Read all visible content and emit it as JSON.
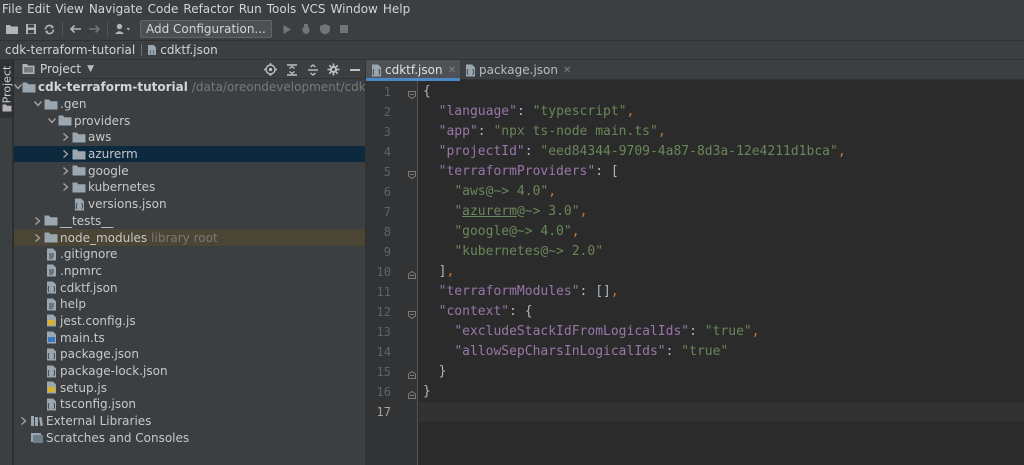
{
  "menu": [
    "File",
    "Edit",
    "View",
    "Navigate",
    "Code",
    "Refactor",
    "Run",
    "Tools",
    "VCS",
    "Window",
    "Help"
  ],
  "toolbar": {
    "add_configuration": "Add Configuration...",
    "icons": [
      "open-folder-icon",
      "save-icon",
      "sync-icon",
      "back-arrow-icon",
      "forward-arrow-icon",
      "user-icon",
      "run-icon",
      "debug-icon",
      "coverage-icon",
      "stop-icon"
    ]
  },
  "breadcrumb": [
    "cdk-terraform-tutorial",
    "cdktf.json"
  ],
  "tool_strip": {
    "label": "Project"
  },
  "project_panel": {
    "title": "Project",
    "icons": [
      "locate-icon",
      "collapse-all-icon",
      "expand-icon",
      "gear-icon",
      "hide-icon"
    ],
    "tree": [
      {
        "label": "cdk-terraform-tutorial",
        "note": "/data/oreondevelopment/cdk-terraform-",
        "type": "folder",
        "depth": 0,
        "arrow": "down",
        "bold": true
      },
      {
        "label": ".gen",
        "note": "",
        "type": "folder",
        "depth": 1,
        "arrow": "down"
      },
      {
        "label": "providers",
        "note": "",
        "type": "folder",
        "depth": 2,
        "arrow": "down"
      },
      {
        "label": "aws",
        "note": "",
        "type": "folder",
        "depth": 3,
        "arrow": "right"
      },
      {
        "label": "azurerm",
        "note": "",
        "type": "folder",
        "depth": 3,
        "arrow": "right",
        "selected": true
      },
      {
        "label": "google",
        "note": "",
        "type": "folder",
        "depth": 3,
        "arrow": "right"
      },
      {
        "label": "kubernetes",
        "note": "",
        "type": "folder",
        "depth": 3,
        "arrow": "right"
      },
      {
        "label": "versions.json",
        "note": "",
        "type": "json",
        "depth": 3,
        "arrow": "none"
      },
      {
        "label": "__tests__",
        "note": "",
        "type": "folder",
        "depth": 1,
        "arrow": "right"
      },
      {
        "label": "node_modules",
        "note": "library root",
        "type": "folder",
        "depth": 1,
        "arrow": "right",
        "excluded": true
      },
      {
        "label": ".gitignore",
        "note": "",
        "type": "file",
        "depth": 1,
        "arrow": "none"
      },
      {
        "label": ".npmrc",
        "note": "",
        "type": "file",
        "depth": 1,
        "arrow": "none"
      },
      {
        "label": "cdktf.json",
        "note": "",
        "type": "json",
        "depth": 1,
        "arrow": "none"
      },
      {
        "label": "help",
        "note": "",
        "type": "file",
        "depth": 1,
        "arrow": "none"
      },
      {
        "label": "jest.config.js",
        "note": "",
        "type": "js",
        "depth": 1,
        "arrow": "none"
      },
      {
        "label": "main.ts",
        "note": "",
        "type": "ts",
        "depth": 1,
        "arrow": "none"
      },
      {
        "label": "package.json",
        "note": "",
        "type": "json",
        "depth": 1,
        "arrow": "none"
      },
      {
        "label": "package-lock.json",
        "note": "",
        "type": "json",
        "depth": 1,
        "arrow": "none"
      },
      {
        "label": "setup.js",
        "note": "",
        "type": "js",
        "depth": 1,
        "arrow": "none"
      },
      {
        "label": "tsconfig.json",
        "note": "",
        "type": "json",
        "depth": 1,
        "arrow": "none"
      },
      {
        "label": "External Libraries",
        "note": "",
        "type": "library",
        "depth": 0,
        "arrow": "right"
      },
      {
        "label": "Scratches and Consoles",
        "note": "",
        "type": "scratch",
        "depth": 0,
        "arrow": "none"
      }
    ]
  },
  "editor": {
    "tabs": [
      {
        "label": "cdktf.json",
        "active": true,
        "close": "✕"
      },
      {
        "label": "package.json",
        "active": false,
        "close": "✕"
      }
    ],
    "current_line": 17,
    "lines": [
      {
        "n": 1,
        "fold": "open",
        "parts": [
          [
            "b",
            "{"
          ]
        ]
      },
      {
        "n": 2,
        "parts": [
          [
            "b",
            "  "
          ],
          [
            "k",
            "\"language\""
          ],
          [
            "b",
            ": "
          ],
          [
            "s",
            "\"typescript\""
          ],
          [
            "p",
            ","
          ]
        ]
      },
      {
        "n": 3,
        "parts": [
          [
            "b",
            "  "
          ],
          [
            "k",
            "\"app\""
          ],
          [
            "b",
            ": "
          ],
          [
            "s",
            "\"npx ts-node main.ts\""
          ],
          [
            "p",
            ","
          ]
        ]
      },
      {
        "n": 4,
        "parts": [
          [
            "b",
            "  "
          ],
          [
            "k",
            "\"projectId\""
          ],
          [
            "b",
            ": "
          ],
          [
            "s",
            "\"eed84344-9709-4a87-8d3a-12e4211d1bca\""
          ],
          [
            "p",
            ","
          ]
        ]
      },
      {
        "n": 5,
        "fold": "open",
        "parts": [
          [
            "b",
            "  "
          ],
          [
            "k",
            "\"terraformProviders\""
          ],
          [
            "b",
            ": ["
          ]
        ]
      },
      {
        "n": 6,
        "parts": [
          [
            "b",
            "    "
          ],
          [
            "s",
            "\"aws@~> 4.0\""
          ],
          [
            "p",
            ","
          ]
        ]
      },
      {
        "n": 7,
        "parts": [
          [
            "b",
            "    "
          ],
          [
            "s",
            "\""
          ],
          [
            "su",
            "azurerm"
          ],
          [
            "s",
            "@~> 3.0\""
          ],
          [
            "p",
            ","
          ]
        ]
      },
      {
        "n": 8,
        "parts": [
          [
            "b",
            "    "
          ],
          [
            "s",
            "\"google@~> 4.0\""
          ],
          [
            "p",
            ","
          ]
        ]
      },
      {
        "n": 9,
        "parts": [
          [
            "b",
            "    "
          ],
          [
            "s",
            "\"kubernetes@~> 2.0\""
          ]
        ]
      },
      {
        "n": 10,
        "fold": "close",
        "parts": [
          [
            "b",
            "  ]"
          ],
          [
            "p",
            ","
          ]
        ]
      },
      {
        "n": 11,
        "parts": [
          [
            "b",
            "  "
          ],
          [
            "k",
            "\"terraformModules\""
          ],
          [
            "b",
            ": []"
          ],
          [
            "p",
            ","
          ]
        ]
      },
      {
        "n": 12,
        "fold": "open",
        "parts": [
          [
            "b",
            "  "
          ],
          [
            "k",
            "\"context\""
          ],
          [
            "b",
            ": {"
          ]
        ]
      },
      {
        "n": 13,
        "parts": [
          [
            "b",
            "    "
          ],
          [
            "k",
            "\"excludeStackIdFromLogicalIds\""
          ],
          [
            "b",
            ": "
          ],
          [
            "s",
            "\"true\""
          ],
          [
            "p",
            ","
          ]
        ]
      },
      {
        "n": 14,
        "parts": [
          [
            "b",
            "    "
          ],
          [
            "k",
            "\"allowSepCharsInLogicalIds\""
          ],
          [
            "b",
            ": "
          ],
          [
            "s",
            "\"true\""
          ]
        ]
      },
      {
        "n": 15,
        "fold": "close",
        "parts": [
          [
            "b",
            "  }"
          ]
        ]
      },
      {
        "n": 16,
        "fold": "close",
        "parts": [
          [
            "b",
            "}"
          ]
        ]
      },
      {
        "n": 17,
        "parts": [
          [
            "b",
            ""
          ]
        ]
      }
    ]
  },
  "colors": {
    "key": "#9876aa",
    "string": "#6a8759",
    "punct": "#cc7832",
    "folder": "#9aa7b0",
    "selection": "#0d293e"
  }
}
